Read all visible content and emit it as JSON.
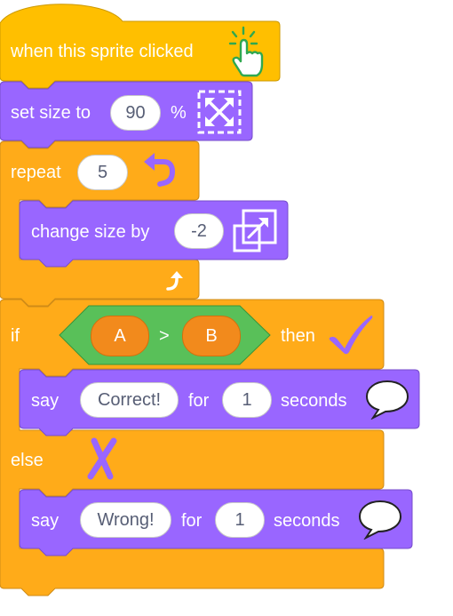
{
  "colors": {
    "events": "#ffbf00",
    "looks": "#9966ff",
    "control": "#ffab19",
    "operators": "#59c059",
    "input_orange": "#f28a1c"
  },
  "hat_block": {
    "label": "when this sprite clicked",
    "icon": "hand-click-icon"
  },
  "set_size": {
    "label": "set size to",
    "value": "90",
    "unit": "%",
    "icon": "expand-arrows-icon"
  },
  "repeat": {
    "label": "repeat",
    "count": "5",
    "icon": "turn-arrow-icon",
    "end_icon": "loop-arrow-icon"
  },
  "change_size": {
    "label": "change size by",
    "value": "-2",
    "icon": "resize-squares-icon"
  },
  "if_block": {
    "if_label": "if",
    "condition": {
      "left": "A",
      "operator": ">",
      "right": "B"
    },
    "then_label": "then",
    "then_icon": "checkmark-icon",
    "else_label": "else",
    "else_icon": "cross-icon"
  },
  "say_correct": {
    "label": "say",
    "text": "Correct!",
    "for_label": "for",
    "secs": "1",
    "seconds_label": "seconds",
    "icon": "speech-bubble-icon"
  },
  "say_wrong": {
    "label": "say",
    "text": "Wrong!",
    "for_label": "for",
    "secs": "1",
    "seconds_label": "seconds",
    "icon": "speech-bubble-icon"
  }
}
